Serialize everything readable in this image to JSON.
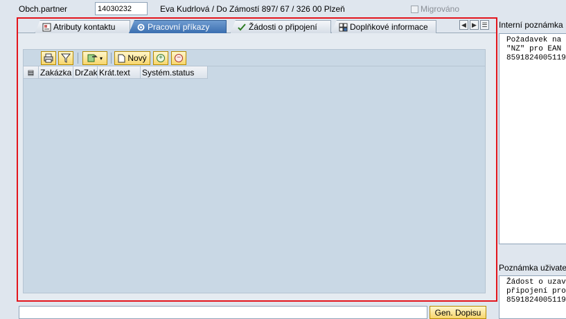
{
  "header": {
    "partner_label": "Obch.partner",
    "partner_value": "14030232",
    "partner_description": "Eva Kudrlová / Do Zámostí 897/ 67 / 326 00 Plzeň",
    "migrated_label": "Migrováno",
    "migrated_checked": false
  },
  "tabs": [
    {
      "label": "Atributy kontaktu",
      "icon": "contact-attributes-icon",
      "active": false
    },
    {
      "label": "Pracovní příkazy",
      "icon": "work-orders-icon",
      "active": true
    },
    {
      "label": "Žádosti o připojení",
      "icon": "connection-requests-icon",
      "active": false
    },
    {
      "label": "Doplňkové informace",
      "icon": "additional-info-icon",
      "active": false
    }
  ],
  "toolbar": {
    "new_label": "Nový"
  },
  "grid": {
    "columns": [
      "Zakázka",
      "DrZak",
      "Krát.text",
      "Systém.status"
    ],
    "rows": []
  },
  "notes": {
    "internal_label": "Interní poznámka",
    "internal_text": "Požadavek na\n\"NZ\" pro EAN\n8591824005119",
    "user_label": "Poznámka uživatel",
    "user_text": "Žádost o uzav\npřipojení pro\n8591824005119"
  },
  "footer": {
    "gen_button_label": "Gen. Dopisu"
  },
  "colors": {
    "highlight_frame": "#e3141b",
    "active_tab": "#3b6fb0",
    "button_yellow": "#f7d66c"
  }
}
